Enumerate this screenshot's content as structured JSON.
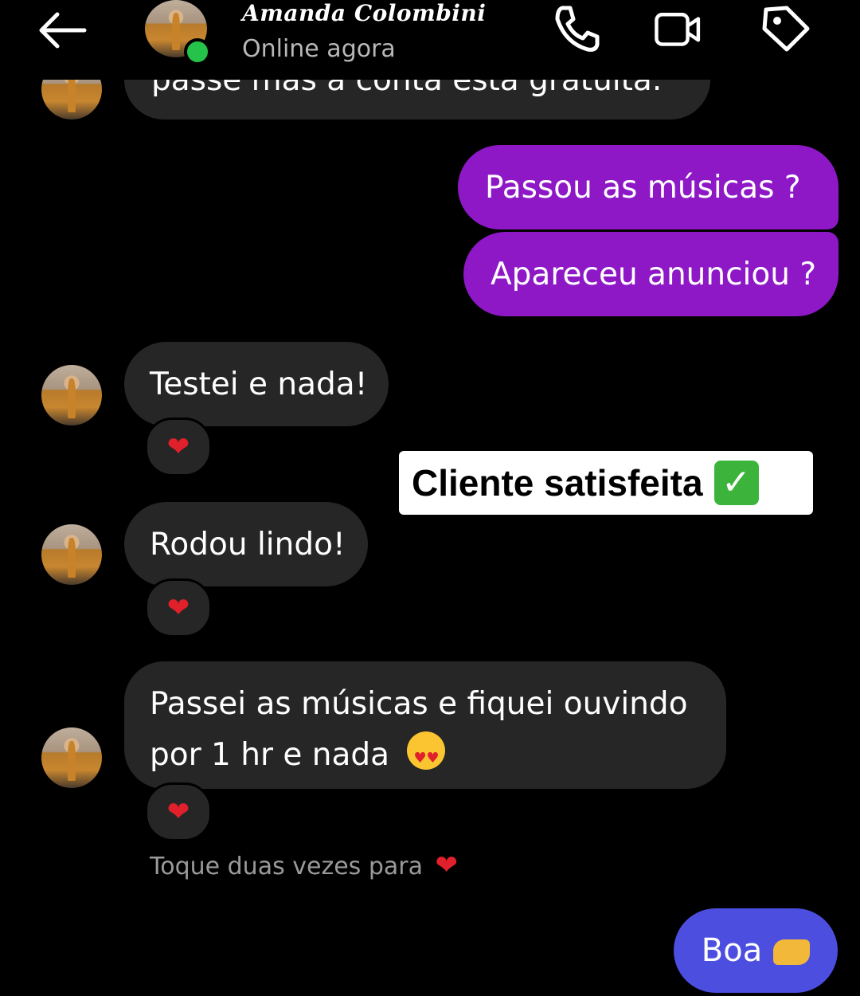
{
  "header": {
    "contact_name": "Amanda Colombini",
    "status": "Online agora"
  },
  "partial_message": "passe mas a conta esta gratuita.",
  "messages_out": [
    {
      "text": "Passou as músicas ?"
    },
    {
      "text": "Apareceu anunciou ?"
    }
  ],
  "messages_in": [
    {
      "text": "Testei e nada!",
      "reaction": "❤"
    },
    {
      "text": "Rodou lindo!",
      "reaction": "❤"
    },
    {
      "line1": "Passei as músicas e fiquei ouvindo",
      "line2": "por 1 hr e nada",
      "reaction": "❤"
    }
  ],
  "overlay": {
    "label": "Cliente satisfeita",
    "check": "✓"
  },
  "hint": {
    "text": "Toque duas vezes para",
    "heart": "❤"
  },
  "reply": {
    "text": "Boa"
  },
  "colors": {
    "outgoing": "#8e18c6",
    "incoming": "#262626",
    "reply": "#4c4ee0",
    "online": "#26c34b"
  }
}
